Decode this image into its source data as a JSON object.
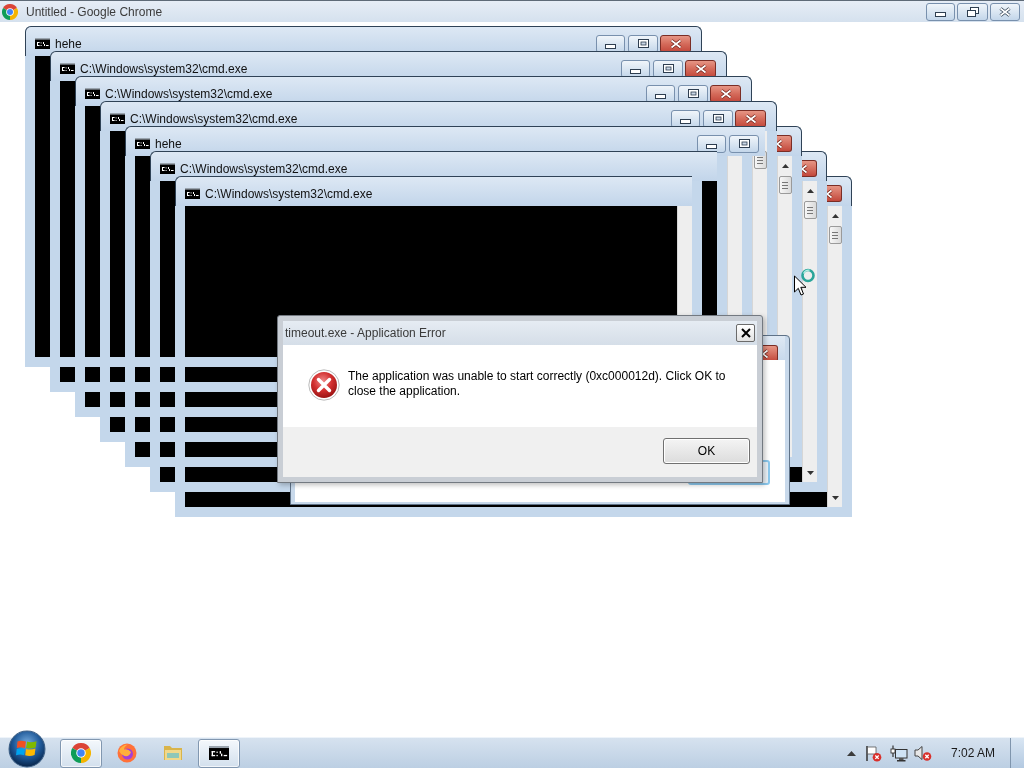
{
  "browser": {
    "title": "Untitled - Google Chrome"
  },
  "console_windows": [
    {
      "title": "hehe"
    },
    {
      "title": "C:\\Windows\\system32\\cmd.exe"
    },
    {
      "title": "C:\\Windows\\system32\\cmd.exe"
    },
    {
      "title": "C:\\Windows\\system32\\cmd.exe"
    },
    {
      "title": "hehe"
    },
    {
      "title": "C:\\Windows\\system32\\cmd.exe"
    },
    {
      "title": "C:\\Windows\\system32\\cmd.exe"
    }
  ],
  "error_dialog": {
    "title": "timeout.exe - Application Error",
    "message": "The application was unable to start correctly (0xc000012d). Click OK to close the application.",
    "button": "OK"
  },
  "taskbar": {
    "apps": [
      {
        "kind": "chrome",
        "running": true
      },
      {
        "kind": "firefox",
        "running": false
      },
      {
        "kind": "folders",
        "running": false
      },
      {
        "kind": "console",
        "running": true
      }
    ],
    "clock": "7:02 AM"
  }
}
